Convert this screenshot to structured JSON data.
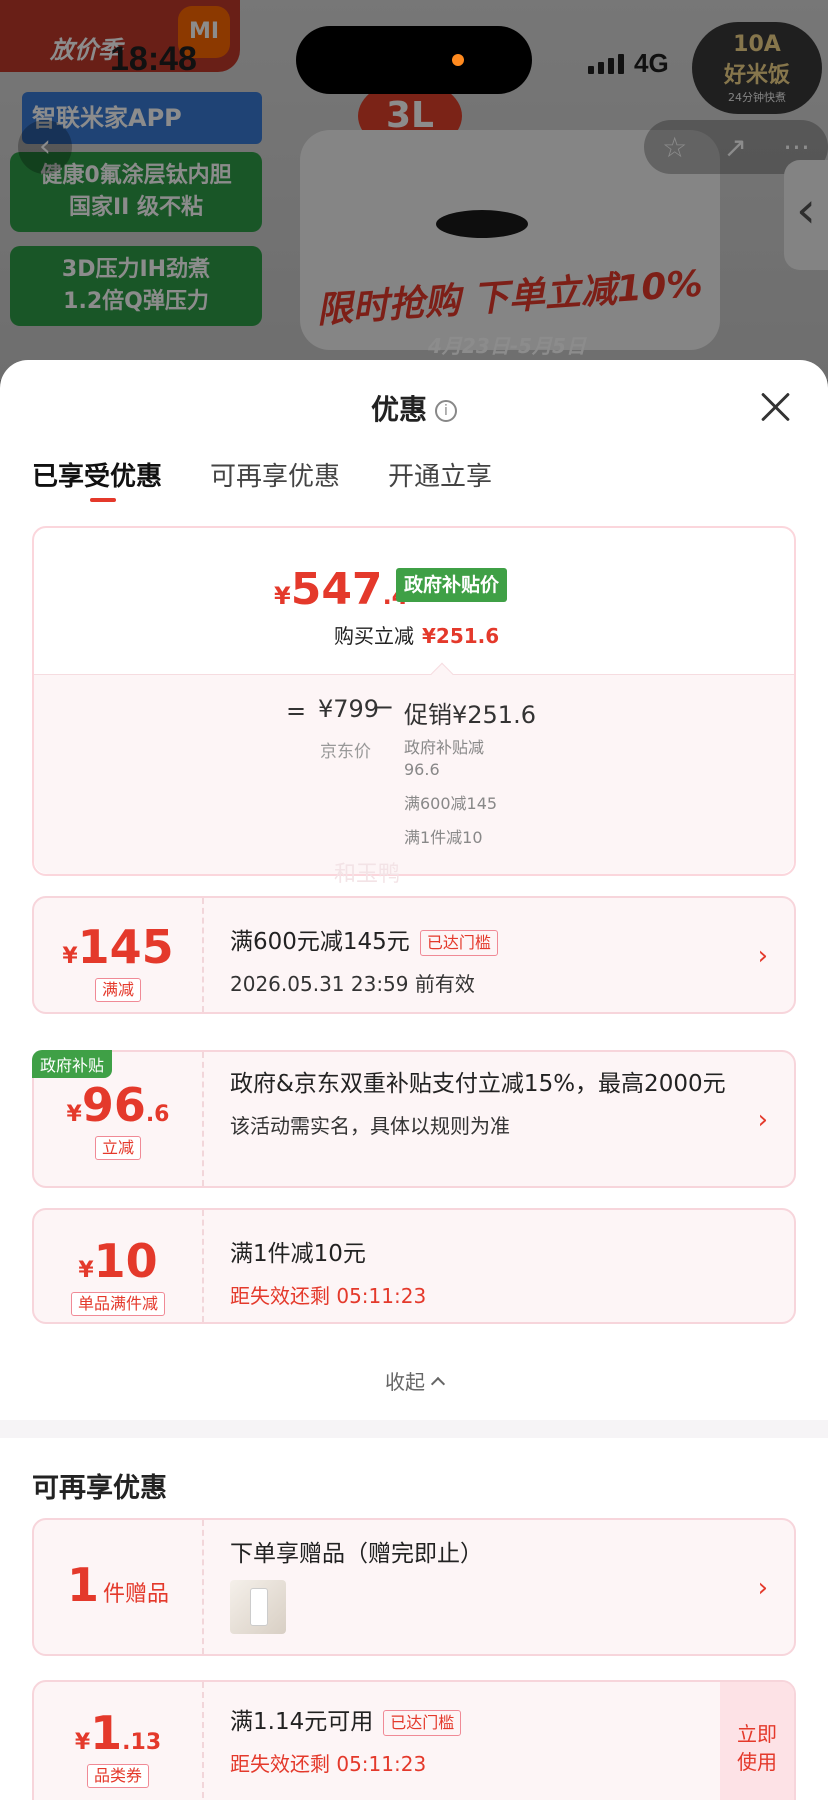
{
  "status_bar": {
    "time": "18:48",
    "network": "4G"
  },
  "background": {
    "banner_tag": "放价季",
    "mi_logo": "MI",
    "app_label": "智联米家APP",
    "features": [
      "健康0氟涂层钛内胆\n国家II 级不粘",
      "3D压力IH劲煮\n1.2倍Q弹压力"
    ],
    "capacity": "3L",
    "sale_text": "限时抢购 下单立减10%",
    "sale_date": "4月23日-5月5日",
    "badge": {
      "line1": "10A",
      "line2": "好米饭",
      "line3": "24分钟快煮"
    }
  },
  "sheet": {
    "title": "优惠",
    "tabs": [
      "已享受优惠",
      "可再享优惠",
      "开通立享"
    ],
    "price": {
      "currency": "¥",
      "integer": "547",
      "decimal": ".4",
      "tag": "政府补贴价",
      "reduce_label": "购买立减",
      "reduce_value": "¥251.6"
    },
    "breakdown": {
      "equals": "=",
      "jd_price": "¥799",
      "jd_label": "京东价",
      "minus": "−",
      "promo_total": "促销¥251.6",
      "items": [
        "政府补贴减96.6",
        "满600减145",
        "满1件减10"
      ]
    },
    "watermark": "和玉鸭",
    "coupons": [
      {
        "currency": "¥",
        "integer": "145",
        "decimal": "",
        "tag": "满减",
        "line1": "满600元减145元",
        "badge": "已达门槛",
        "line2": "2026.05.31 23:59 前有效"
      },
      {
        "corner": "政府补贴",
        "currency": "¥",
        "integer": "96",
        "decimal": ".6",
        "tag": "立减",
        "line1": "政府&京东双重补贴支付立减15%，最高2000元",
        "line2": "该活动需实名，具体以规则为准"
      },
      {
        "currency": "¥",
        "integer": "10",
        "decimal": "",
        "tag": "单品满件减",
        "line1": "满1件减10元",
        "line2": "距失效还剩 05:11:23"
      }
    ],
    "collapse_label": "收起",
    "more_section": {
      "title": "可再享优惠",
      "gift": {
        "count": "1",
        "unit": "件赠品",
        "line1": "下单享赠品（赠完即止）"
      },
      "coupon": {
        "currency": "¥",
        "integer": "1",
        "decimal": ".13",
        "tag": "品类券",
        "line1": "满1.14元可用",
        "badge": "已达门槛",
        "line2": "距失效还剩 05:11:23",
        "action": "立即\n使用"
      }
    }
  },
  "colors": {
    "accent_red": "#e4392b",
    "gov_green": "#3fa046",
    "card_border": "#fbd6dc"
  }
}
